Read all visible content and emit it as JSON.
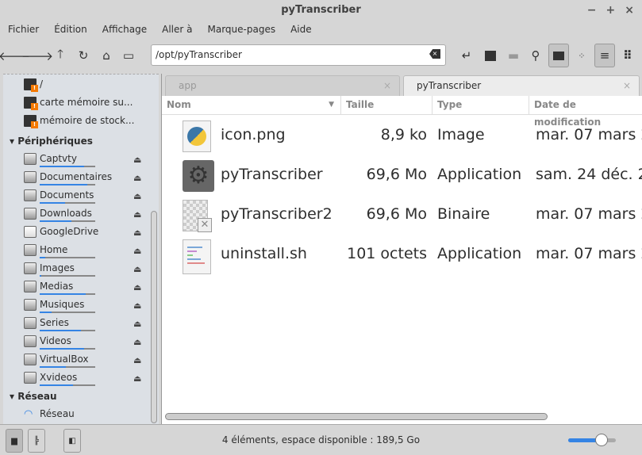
{
  "window": {
    "title": "pyTranscriber",
    "controls": [
      "−",
      "+",
      "×"
    ]
  },
  "menu": [
    "Fichier",
    "Édition",
    "Affichage",
    "Aller à",
    "Marque-pages",
    "Aide"
  ],
  "toolbar": {
    "path": "/opt/pyTranscriber",
    "nav_icons": [
      "back-icon",
      "forward-icon",
      "up-icon",
      "reload-icon",
      "home-icon",
      "computer-icon"
    ]
  },
  "sidebar": {
    "places": [
      {
        "label": "/"
      },
      {
        "label": "carte mémoire su..."
      },
      {
        "label": "mémoire de stock..."
      }
    ],
    "devices_header": "Périphériques",
    "devices": [
      {
        "label": "Captvty",
        "usage": 0.8
      },
      {
        "label": "Documentaires",
        "usage": 0.86
      },
      {
        "label": "Documents",
        "usage": 0.45
      },
      {
        "label": "Downloads",
        "usage": 0.57
      },
      {
        "label": "GoogleDrive",
        "usage": null
      },
      {
        "label": "Home",
        "usage": 0.1
      },
      {
        "label": "Images",
        "usage": 0.03
      },
      {
        "label": "Medias",
        "usage": 0.83
      },
      {
        "label": "Musiques",
        "usage": 0.22
      },
      {
        "label": "Series",
        "usage": 0.74
      },
      {
        "label": "Videos",
        "usage": 0.8
      },
      {
        "label": "VirtualBox",
        "usage": 0.47
      },
      {
        "label": "Xvideos",
        "usage": 0.6
      }
    ],
    "network_header": "Réseau",
    "network": [
      {
        "label": "Réseau"
      }
    ]
  },
  "tabs": [
    {
      "label": "app",
      "close": "×"
    },
    {
      "label": "pyTranscriber",
      "close": "×"
    }
  ],
  "columns": [
    "Nom",
    "Taille",
    "Type",
    "Date de modification"
  ],
  "files": [
    {
      "name": "icon.png",
      "size": "8,9 ko",
      "type": "Image",
      "date": "mar. 07 mars 2"
    },
    {
      "name": "pyTranscriber",
      "size": "69,6 Mo",
      "type": "Application",
      "date": "sam. 24 déc. 2"
    },
    {
      "name": "pyTranscriber2",
      "size": "69,6 Mo",
      "type": "Binaire",
      "date": "mar. 07 mars 2"
    },
    {
      "name": "uninstall.sh",
      "size": "101 octets",
      "type": "Application",
      "date": "mar. 07 mars 2"
    }
  ],
  "status": {
    "text": "4 éléments, espace disponible : 189,5 Go",
    "zoom": 0.7
  }
}
